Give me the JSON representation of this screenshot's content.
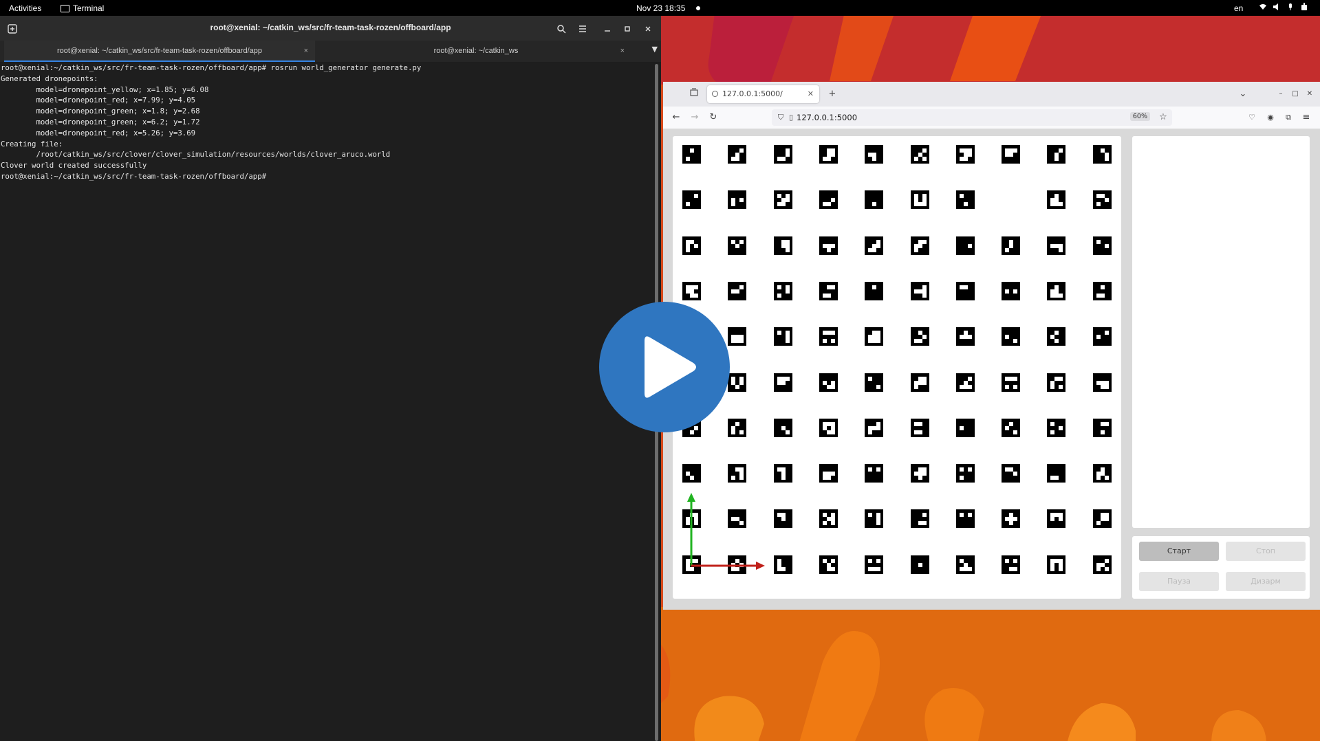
{
  "topbar": {
    "activities": "Activities",
    "app_name": "Terminal",
    "clock": "Nov 23  18:35",
    "lang": "en"
  },
  "terminal": {
    "title": "root@xenial: ~/catkin_ws/src/fr-team-task-rozen/offboard/app",
    "tabs": [
      {
        "label": "root@xenial: ~/catkin_ws/src/fr-team-task-rozen/offboard/app",
        "active": true
      },
      {
        "label": "root@xenial: ~/catkin_ws",
        "active": false
      }
    ],
    "lines": [
      "root@xenial:~/catkin_ws/src/fr-team-task-rozen/offboard/app# rosrun world_generator generate.py",
      "Generated dronepoints:",
      "        model=dronepoint_yellow; x=1.85; y=6.08",
      "        model=dronepoint_red; x=7.99; y=4.05",
      "        model=dronepoint_green; x=1.8; y=2.68",
      "        model=dronepoint_green; x=6.2; y=1.72",
      "        model=dronepoint_red; x=5.26; y=3.69",
      "Creating file:",
      "        /root/catkin_ws/src/clover/clover_simulation/resources/worlds/clover_aruco.world",
      "Clover world created successfully",
      "root@xenial:~/catkin_ws/src/fr-team-task-rozen/offboard/app#"
    ]
  },
  "browser": {
    "tab_title": "127.0.0.1:5000/",
    "url": "127.0.0.1:5000",
    "zoom": "60%",
    "buttons": {
      "start": "Старт",
      "stop": "Стоп",
      "pause": "Пауза",
      "disarm": "Дизарм"
    }
  },
  "colors": {
    "accent": "#3584e4",
    "wallpaper": "#d84a1b",
    "play": "#2f76c0",
    "axis_x": "#c0201a",
    "axis_y": "#21b321"
  }
}
